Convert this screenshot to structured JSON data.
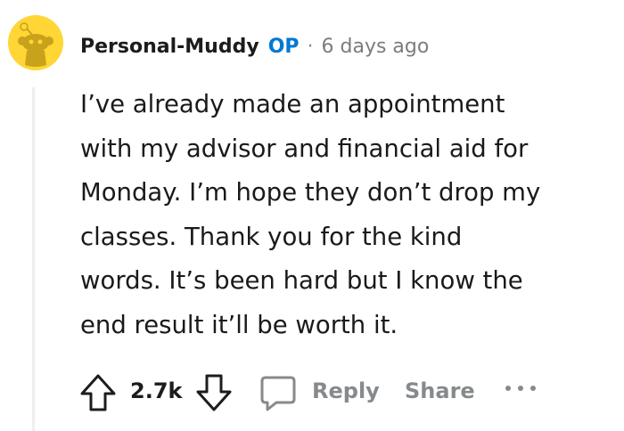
{
  "comment": {
    "author": "Personal-Muddy",
    "op_badge": "OP",
    "separator": "·",
    "time": "6 days ago",
    "body_lines": [
      "I’ve already made an appointment",
      "with my advisor and financial aid for",
      "Monday. I’m hope they don’t drop my",
      "classes. Thank you for the kind",
      "words. It’s been hard but I know the",
      "end result it’ll be worth it."
    ]
  },
  "actions": {
    "score": "2.7k",
    "reply_label": "Reply",
    "share_label": "Share"
  },
  "icons": {
    "avatar": "snoo-avatar-icon",
    "upvote": "upvote-arrow-icon",
    "downvote": "downvote-arrow-icon",
    "comment": "speech-bubble-icon",
    "more": "ellipsis-icon"
  },
  "colors": {
    "op_badge": "#0079d3",
    "avatar_bg": "#ffd635",
    "muted": "#878a8c",
    "thread_line": "#edeff1"
  }
}
